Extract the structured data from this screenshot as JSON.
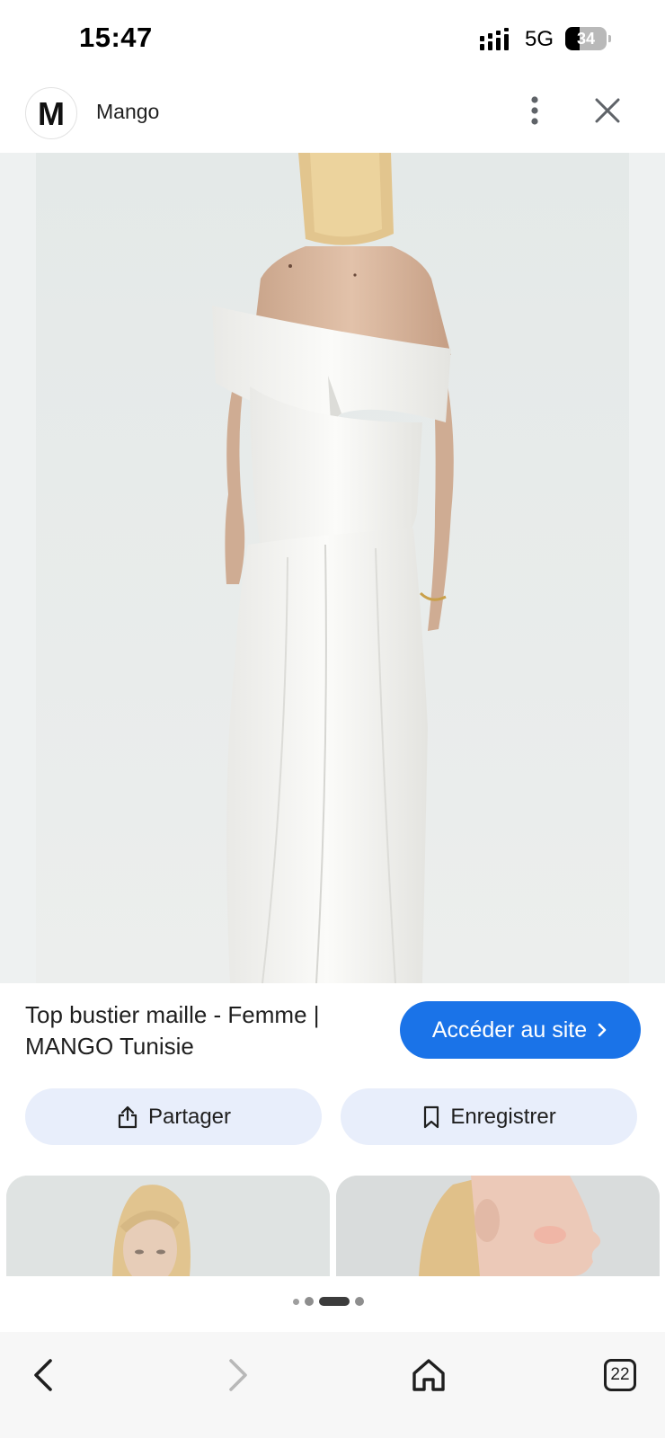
{
  "status_bar": {
    "time": "15:47",
    "network": "5G",
    "battery_percent": "34",
    "battery_level": 0.34,
    "signal_icon": "cellular-signal-icon"
  },
  "header": {
    "logo_letter": "M",
    "site_name": "Mango",
    "more_icon": "more-vertical-icon",
    "close_icon": "close-icon"
  },
  "result": {
    "title": "Top bustier maille - Femme | MANGO Tunisie",
    "visit_label": "Accéder au site",
    "visit_icon": "chevron-right-icon"
  },
  "actions": {
    "share_label": "Partager",
    "share_icon": "share-icon",
    "save_label": "Enregistrer",
    "save_icon": "bookmark-icon"
  },
  "pager": {
    "count": 4,
    "active_index": 2
  },
  "bottom_nav": {
    "back_icon": "back-arrow-icon",
    "forward_icon": "forward-arrow-icon",
    "home_icon": "home-icon",
    "tabs_count": "22"
  },
  "colors": {
    "accent": "#1a73e8",
    "pill_bg": "#e8eefb"
  }
}
